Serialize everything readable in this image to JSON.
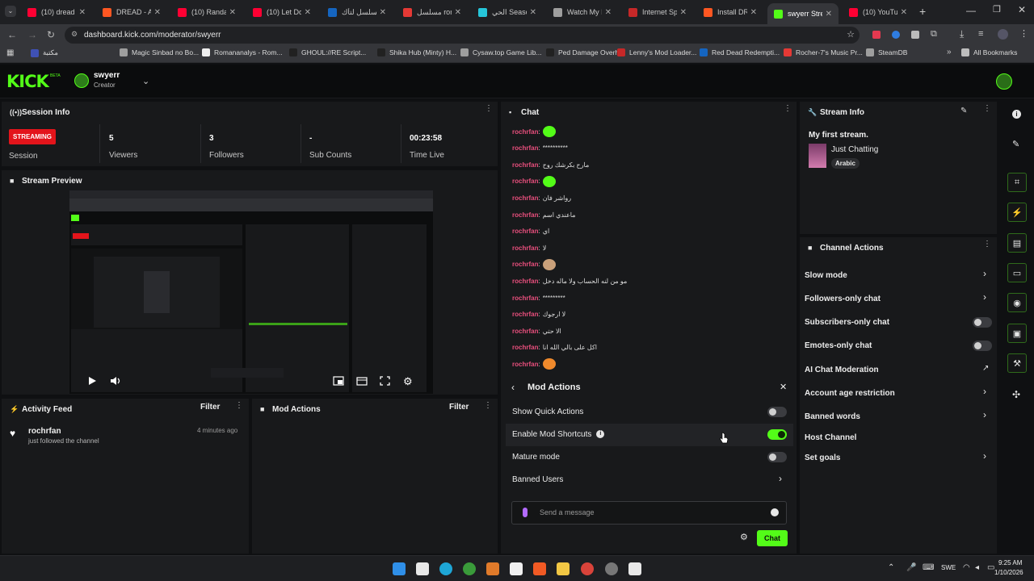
{
  "browser": {
    "tabs": [
      {
        "label": "(10) dread re",
        "color": "#ff0033"
      },
      {
        "label": "DREAD - A N",
        "color": "#ff5722"
      },
      {
        "label": "(10) Randar",
        "color": "#ff0033"
      },
      {
        "label": "(10) Let Dow",
        "color": "#ff0033"
      },
      {
        "label": "مسلسل لتأك",
        "color": "#1565c0"
      },
      {
        "label": "مسلسل rom",
        "color": "#e53935"
      },
      {
        "label": "الحي Season",
        "color": "#26c6da"
      },
      {
        "label": "Watch My H",
        "color": "#9e9e9e"
      },
      {
        "label": "Internet Spe",
        "color": "#c62828"
      },
      {
        "label": "Install DREAD",
        "color": "#ff5722"
      },
      {
        "label": "swyerr Strea",
        "color": "#53fc18"
      },
      {
        "label": "(10) YouTube",
        "color": "#ff0033"
      }
    ],
    "active_tab_index": 10,
    "url": "dashboard.kick.com/moderator/swyerr",
    "bookmarks": [
      {
        "label": "مكتبة",
        "color": "#3f51b5"
      },
      {
        "label": "Magic Sinbad no Bo...",
        "color": "#9e9e9e"
      },
      {
        "label": "Romananalys - Rom...",
        "color": "#eeeeee"
      },
      {
        "label": "GHOUL://RE Script...",
        "color": "#212121"
      },
      {
        "label": "Shika Hub (Minty) H...",
        "color": "#212121"
      },
      {
        "label": "Cysaw.top Game Lib...",
        "color": "#9e9e9e"
      },
      {
        "label": "Ped Damage Overh...",
        "color": "#212121"
      },
      {
        "label": "Lenny's Mod Loader...",
        "color": "#c62828"
      },
      {
        "label": "Red Dead Redempti...",
        "color": "#1565c0"
      },
      {
        "label": "Rocher-7's Music Pr...",
        "color": "#e53935"
      },
      {
        "label": "SteamDB",
        "color": "#9e9e9e"
      }
    ],
    "all_bookmarks_label": "All Bookmarks"
  },
  "header": {
    "logo": "KICK",
    "logo_badge": "BETA",
    "channel_name": "swyerr",
    "channel_role": "Creator"
  },
  "session": {
    "title": "Session Info",
    "badge": "STREAMING",
    "session_label": "Session",
    "stats": [
      {
        "value": "5",
        "label": "Viewers"
      },
      {
        "value": "3",
        "label": "Followers"
      },
      {
        "value": "-",
        "label": "Sub Counts"
      },
      {
        "value": "00:23:58",
        "label": "Time Live"
      }
    ]
  },
  "preview": {
    "title": "Stream Preview"
  },
  "activity": {
    "title": "Activity Feed",
    "filter": "Filter",
    "items": [
      {
        "user": "rochrfan",
        "text": "just followed the channel",
        "time": "4 minutes ago"
      }
    ]
  },
  "mod_actions_panel": {
    "title": "Mod Actions",
    "filter": "Filter"
  },
  "chat": {
    "title": "Chat",
    "messages": [
      {
        "user": "rochrfan",
        "text": "",
        "emote": "green-smile"
      },
      {
        "user": "rochrfan",
        "text": "**********"
      },
      {
        "user": "rochrfan",
        "text": "مارح بكرشك روح"
      },
      {
        "user": "rochrfan",
        "text": "",
        "emote": "green-smile"
      },
      {
        "user": "rochrfan",
        "text": "رواشر فان"
      },
      {
        "user": "rochrfan",
        "text": "ماعندي اسم"
      },
      {
        "user": "rochrfan",
        "text": "اي"
      },
      {
        "user": "rochrfan",
        "text": "لا"
      },
      {
        "user": "rochrfan",
        "text": "",
        "emote": "cat"
      },
      {
        "user": "rochrfan",
        "text": "مو من لنه الحساب ولا ماله دخل"
      },
      {
        "user": "rochrfan",
        "text": "*********"
      },
      {
        "user": "rochrfan",
        "text": "لا ارجوك"
      },
      {
        "user": "rochrfan",
        "text": "الا حتي"
      },
      {
        "user": "rochrfan",
        "text": "اكل على بالي الله انا"
      },
      {
        "user": "rochrfan",
        "text": "",
        "emote": "fire"
      }
    ],
    "mod_actions": {
      "title": "Mod Actions",
      "rows": [
        {
          "label": "Show Quick Actions",
          "type": "toggle",
          "on": false
        },
        {
          "label": "Enable Mod Shortcuts",
          "type": "toggle",
          "on": true,
          "info": true
        },
        {
          "label": "Mature mode",
          "type": "toggle",
          "on": false
        },
        {
          "label": "Banned Users",
          "type": "link"
        }
      ]
    },
    "input_placeholder": "Send a message",
    "send_label": "Chat"
  },
  "stream_info": {
    "title": "Stream Info",
    "stream_title": "My first stream.",
    "category": "Just Chatting",
    "language": "Arabic"
  },
  "channel_actions": {
    "title": "Channel Actions",
    "rows": [
      {
        "label": "Slow mode",
        "type": "link"
      },
      {
        "label": "Followers-only chat",
        "type": "link"
      },
      {
        "label": "Subscribers-only chat",
        "type": "toggle",
        "on": false
      },
      {
        "label": "Emotes-only chat",
        "type": "toggle",
        "on": false
      },
      {
        "label": "AI Chat Moderation",
        "type": "external"
      },
      {
        "label": "Account age restriction",
        "type": "link"
      },
      {
        "label": "Banned words",
        "type": "link"
      },
      {
        "label": "Host Channel",
        "type": "none"
      },
      {
        "label": "Set goals",
        "type": "link"
      }
    ]
  },
  "taskbar": {
    "lang": "SWE",
    "time": "9:25 AM",
    "date": "1/10/2026"
  },
  "colors": {
    "accent": "#53fc18",
    "live_red": "#e3141b",
    "username": "#e94f7d",
    "panel": "#18191b",
    "background": "#0f1012"
  }
}
